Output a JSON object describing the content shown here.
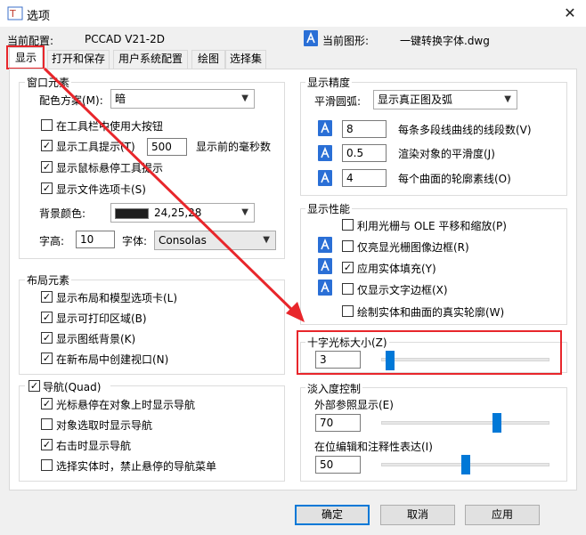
{
  "window": {
    "title": "选项",
    "close_label": "✕"
  },
  "header": {
    "current_config_label": "当前配置:",
    "current_config_value": "PCCAD V21-2D",
    "current_drawing_label": "当前图形:",
    "current_drawing_value": "一键转换字体.dwg"
  },
  "tabs": [
    "显示",
    "打开和保存",
    "用户系统配置",
    "绘图",
    "选择集"
  ],
  "window_elements": {
    "title": "窗口元素",
    "color_scheme_label": "配色方案(M):",
    "color_scheme_value": "暗",
    "large_buttons": {
      "label": "在工具栏中使用大按钮",
      "checked": false
    },
    "tooltips": {
      "label": "显示工具提示(T)",
      "checked": true
    },
    "tooltip_delay": "500",
    "tooltip_delay_suffix": "显示前的毫秒数",
    "rollover_tooltips": {
      "label": "显示鼠标悬停工具提示",
      "checked": true
    },
    "file_tabs": {
      "label": "显示文件选项卡(S)",
      "checked": true
    },
    "bg_color_label": "背景颜色:",
    "bg_color_value": "24,25,28",
    "font_size_label": "字高:",
    "font_size_value": "10",
    "font_label": "字体:",
    "font_value": "Consolas"
  },
  "layout_elements": {
    "title": "布局元素",
    "items": [
      {
        "label": "显示布局和模型选项卡(L)",
        "checked": true
      },
      {
        "label": "显示可打印区域(B)",
        "checked": true
      },
      {
        "label": "显示图纸背景(K)",
        "checked": true
      },
      {
        "label": "在新布局中创建视口(N)",
        "checked": true
      }
    ]
  },
  "navigation": {
    "title": "导航(Quad)",
    "checked": true,
    "items": [
      {
        "label": "光标悬停在对象上时显示导航",
        "checked": true
      },
      {
        "label": "对象选取时显示导航",
        "checked": false
      },
      {
        "label": "右击时显示导航",
        "checked": true
      },
      {
        "label": "选择实体时，禁止悬停的导航菜单",
        "checked": false
      }
    ]
  },
  "display_resolution": {
    "title": "显示精度",
    "arc_smooth_label": "平滑圆弧:",
    "arc_smooth_value": "显示真正图及弧",
    "rows": [
      {
        "value": "8",
        "label": "每条多段线曲线的线段数(V)"
      },
      {
        "value": "0.5",
        "label": "渲染对象的平滑度(J)"
      },
      {
        "value": "4",
        "label": "每个曲面的轮廓素线(O)"
      }
    ]
  },
  "display_performance": {
    "title": "显示性能",
    "items": [
      {
        "label": "利用光栅与 OLE 平移和缩放(P)",
        "checked": false
      },
      {
        "label": "仅亮显光栅图像边框(R)",
        "checked": false
      },
      {
        "label": "应用实体填充(Y)",
        "checked": true
      },
      {
        "label": "仅显示文字边框(X)",
        "checked": false
      },
      {
        "label": "绘制实体和曲面的真实轮廓(W)",
        "checked": false
      }
    ]
  },
  "crosshair": {
    "title": "十字光标大小(Z)",
    "value": "3",
    "level_percent": 3
  },
  "fade": {
    "title": "淡入度控制",
    "xref_label": "外部参照显示(E)",
    "xref_value": "70",
    "xref_level_percent": 70,
    "inplace_label": "在位编辑和注释性表达(I)",
    "inplace_value": "50",
    "inplace_level_percent": 50
  },
  "buttons": {
    "ok": "确定",
    "cancel": "取消",
    "apply": "应用"
  },
  "colors": {
    "accent": "#0078d7",
    "annotation_red": "#e8262b",
    "swatch": "#18191c"
  }
}
